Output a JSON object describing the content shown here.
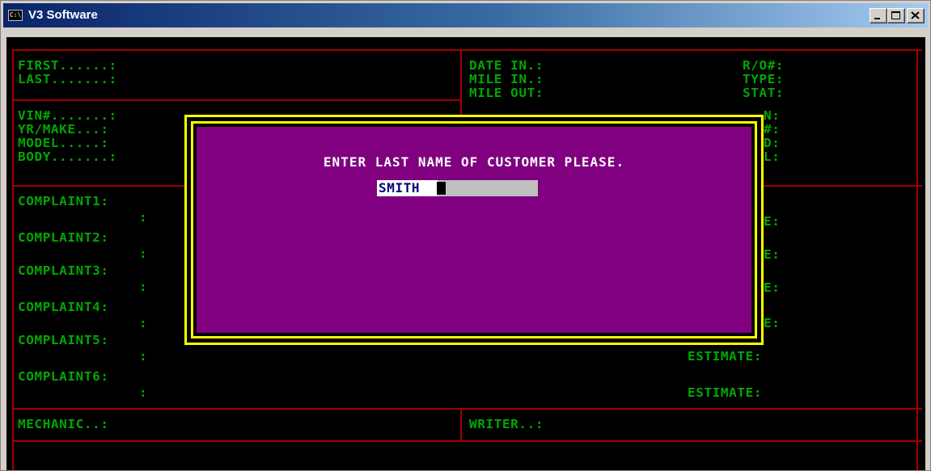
{
  "window": {
    "title": "V3 Software",
    "icon_label": "C:\\",
    "buttons": [
      "minimize",
      "maximize",
      "close"
    ]
  },
  "colors": {
    "console_bg": "#000000",
    "field_label": "#00a800",
    "frame_line": "#a00000",
    "dialog_bg": "#800080",
    "dialog_border": "#ffff00",
    "dialog_text": "#ffffff",
    "input_bg": "#c0c0c0",
    "input_text": "#000080"
  },
  "form": {
    "first": "FIRST......:",
    "last": "LAST.......:",
    "vin": "VIN#.......:",
    "yr_make": "YR/MAKE...:",
    "model": "MODEL.....:",
    "body": "BODY.......:",
    "date_in": "DATE IN.:",
    "mile_in": "MILE IN.:",
    "mile_out": "MILE OUT:",
    "ro": "R/O#:",
    "type": "TYPE:",
    "stat": "STAT:",
    "right_partial": [
      "N:",
      "#:",
      "D:",
      "L:"
    ],
    "complaints": [
      "COMPLAINT1:",
      "COMPLAINT2:",
      "COMPLAINT3:",
      "COMPLAINT4:",
      "COMPLAINT5:",
      "COMPLAINT6:"
    ],
    "continuation_colon": ":",
    "estimate_partial": "E:",
    "estimate": "ESTIMATE:",
    "mechanic": "MECHANIC..:",
    "writer": "WRITER..:"
  },
  "dialog": {
    "prompt": "ENTER LAST NAME OF CUSTOMER PLEASE.",
    "input_value": "SMITH"
  }
}
